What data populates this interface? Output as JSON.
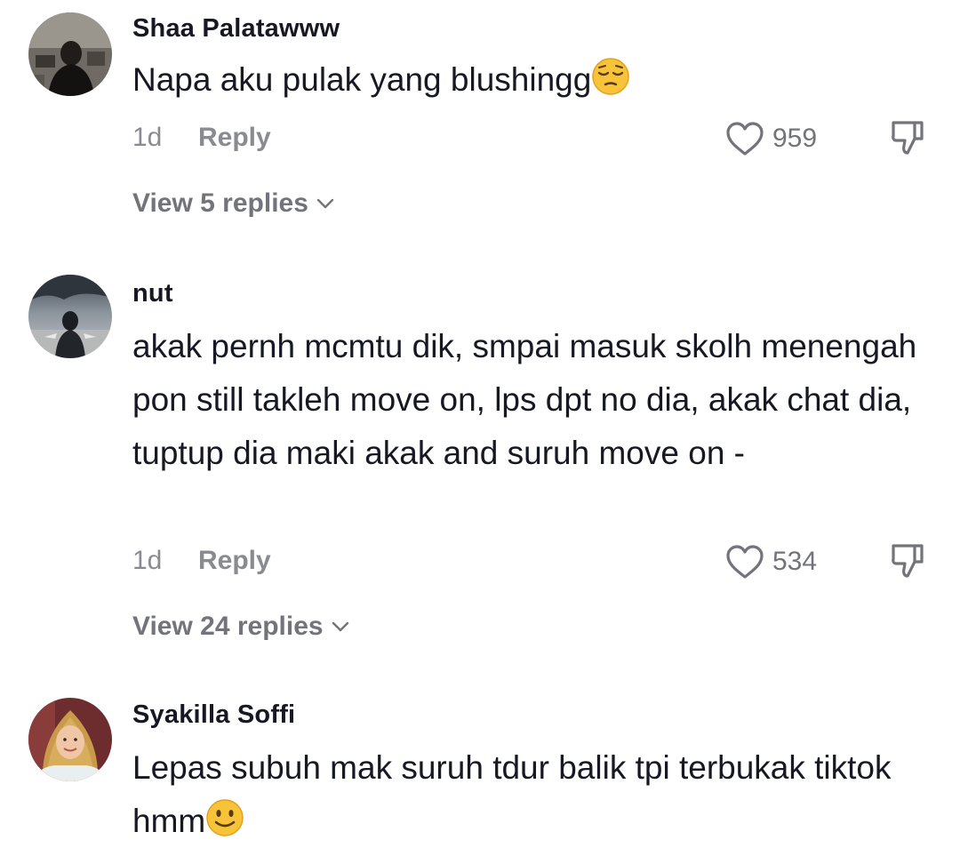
{
  "comments": [
    {
      "username": "Shaa Palatawww",
      "text": "Napa aku pulak yang blushingg",
      "emoji": "pensive-face",
      "time": "1d",
      "reply_label": "Reply",
      "likes": "959",
      "view_replies": "View 5 replies"
    },
    {
      "username": "nut",
      "text": "akak pernh mcmtu dik, smpai masuk skolh menengah pon still takleh move on, lps dpt no dia, akak chat dia, tuptup dia maki akak and suruh move on -",
      "time": "1d",
      "reply_label": "Reply",
      "likes": "534",
      "view_replies": "View 24 replies"
    },
    {
      "username": "Syakilla Soffi",
      "text": "Lepas subuh mak suruh tdur balik tpi terbukak tiktok hmm",
      "emoji": "slightly-smiling-face"
    }
  ],
  "colors": {
    "text_primary": "#161823",
    "text_secondary": "#8a8b91",
    "icon": "#73747b"
  },
  "icons": {
    "like": "heart-outline-icon",
    "dislike": "thumbs-down-icon",
    "expand": "chevron-down-icon"
  }
}
